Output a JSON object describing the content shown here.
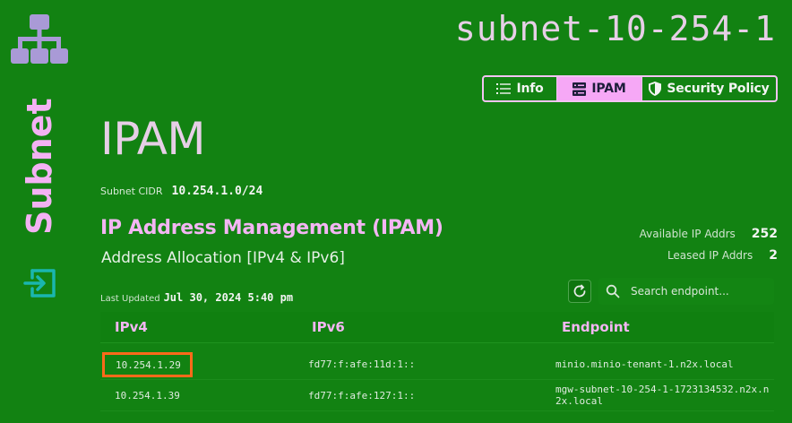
{
  "resource": {
    "name": "subnet-10-254-1",
    "kind_label": "Subnet"
  },
  "tabs": [
    {
      "label": "Info",
      "icon": "list-icon",
      "active": false
    },
    {
      "label": "IPAM",
      "icon": "server-icon",
      "active": true
    },
    {
      "label": "Security Policy",
      "icon": "shield-icon",
      "active": false
    }
  ],
  "page": {
    "heading": "IPAM",
    "cidr_label": "Subnet CIDR",
    "cidr_value": "10.254.1.0/24",
    "section_title": "IP Address Management (IPAM)",
    "section_subtitle": "Address Allocation [IPv4 & IPv6]"
  },
  "stats": [
    {
      "label": "Available IP Addrs",
      "value": "252"
    },
    {
      "label": "Leased IP Addrs",
      "value": "2"
    }
  ],
  "updated": {
    "label": "Last Updated",
    "value": "Jul 30, 2024 5:40 pm"
  },
  "search": {
    "placeholder": "Search endpoint...",
    "value": ""
  },
  "table": {
    "columns": [
      "IPv4",
      "IPv6",
      "Endpoint"
    ],
    "rows": [
      {
        "ipv4": "10.254.1.29",
        "ipv6": "fd77:f:afe:11d:1::",
        "endpoint": "minio.minio-tenant-1.n2x.local",
        "highlighted": true
      },
      {
        "ipv4": "10.254.1.39",
        "ipv6": "fd77:f:afe:127:1::",
        "endpoint": "mgw-subnet-10-254-1-1723134532.n2x.n2x.local",
        "highlighted": false
      }
    ]
  },
  "colors": {
    "background": "#128212",
    "accent_pink": "#f3b6f3",
    "logo_lavender": "#a99ad6",
    "exit_icon_teal": "#1ab6b0",
    "highlight_orange": "#ff6a1a"
  }
}
